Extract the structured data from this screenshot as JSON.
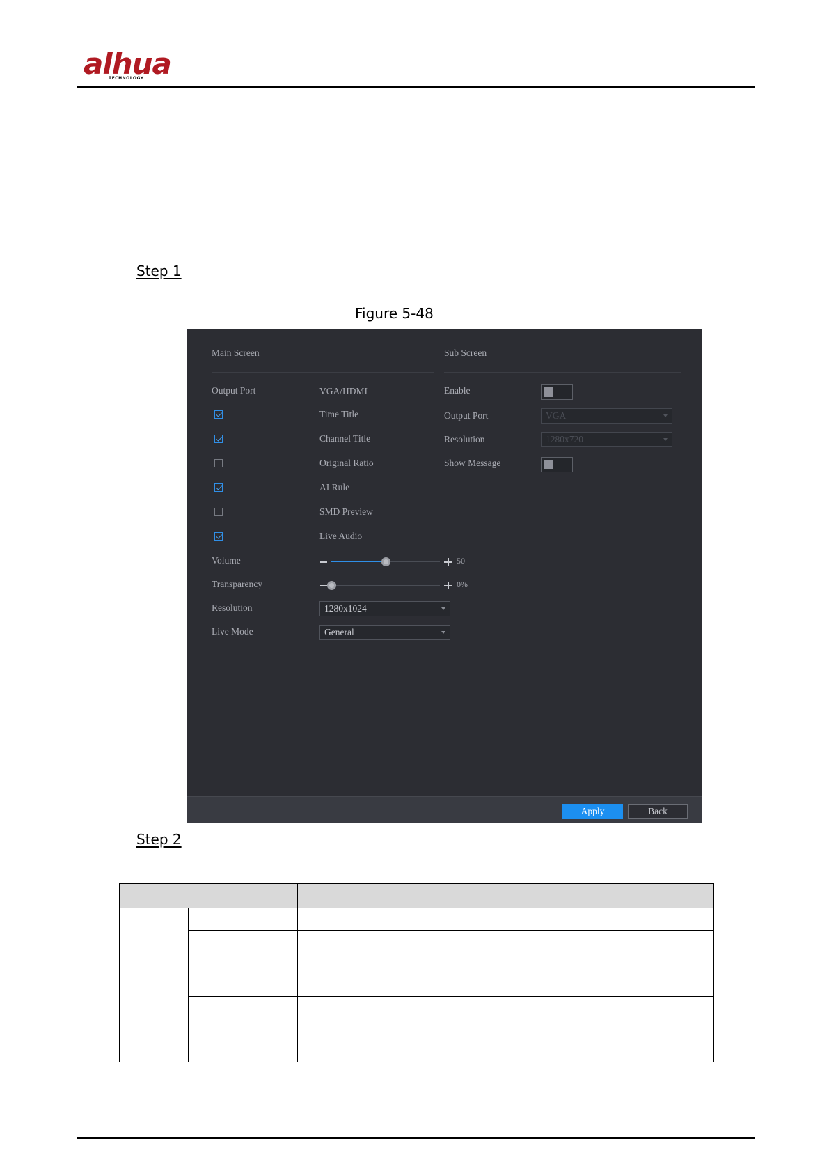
{
  "header": {
    "logo_text": "alhua",
    "logo_subtext": "TECHNOLOGY"
  },
  "steps": {
    "step1": "Step 1",
    "step2": "Step 2"
  },
  "figure": {
    "caption": "Figure 5-48"
  },
  "ui": {
    "main_screen": {
      "heading": "Main Screen",
      "output_port_label": "Output Port",
      "output_port_value": "VGA/HDMI",
      "options": [
        {
          "label": "Time Title",
          "checked": true
        },
        {
          "label": "Channel Title",
          "checked": true
        },
        {
          "label": "Original Ratio",
          "checked": false
        },
        {
          "label": "AI Rule",
          "checked": true
        },
        {
          "label": "SMD Preview",
          "checked": false
        },
        {
          "label": "Live Audio",
          "checked": true
        }
      ],
      "volume": {
        "label": "Volume",
        "value": 50,
        "value_text": "50"
      },
      "transparency": {
        "label": "Transparency",
        "value": 0,
        "value_text": "0%"
      },
      "resolution": {
        "label": "Resolution",
        "value": "1280x1024"
      },
      "live_mode": {
        "label": "Live Mode",
        "value": "General"
      }
    },
    "sub_screen": {
      "heading": "Sub Screen",
      "enable_label": "Enable",
      "enable_on": false,
      "output_port_label": "Output Port",
      "output_port_value": "VGA",
      "resolution_label": "Resolution",
      "resolution_value": "1280x720",
      "show_message_label": "Show Message",
      "show_message_on": false
    },
    "buttons": {
      "apply": "Apply",
      "back": "Back"
    },
    "colors": {
      "background": "#2c2d33",
      "accent": "#1c8ff0",
      "text": "#a9abb3"
    }
  },
  "table": {
    "header": [
      "",
      ""
    ],
    "rows": [
      [
        "",
        "",
        ""
      ],
      [
        "",
        ""
      ],
      [
        "",
        ""
      ]
    ]
  }
}
